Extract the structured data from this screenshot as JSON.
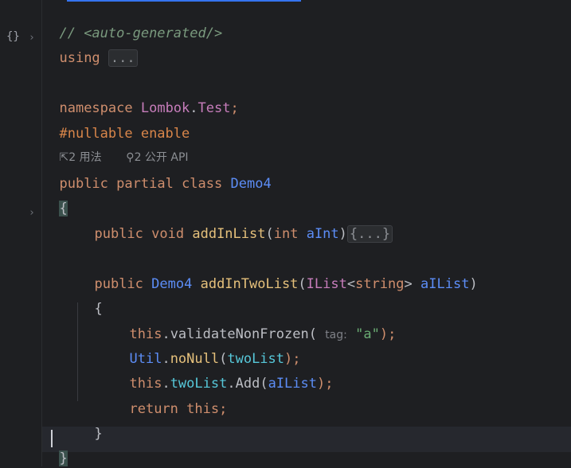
{
  "gutter": {
    "braces_icon": "{}",
    "chevron": "›"
  },
  "code": {
    "line1_comment": "// <auto-generated/>",
    "line2_kw": "using",
    "line2_fold": "...",
    "line4_kw": "namespace",
    "line4_ns1": "Lombok",
    "line4_dot": ".",
    "line4_ns2": "Test",
    "line4_semi": ";",
    "line5_pp": "#nullable enable",
    "hint_usages": "2 用法",
    "hint_api": "2 公开 API",
    "line7_kw1": "public",
    "line7_kw2": "partial",
    "line7_kw3": "class",
    "line7_type": "Demo4",
    "line8_brace": "{",
    "line9_kw1": "public",
    "line9_kw2": "void",
    "line9_fn": "addInList",
    "line9_p1": "(",
    "line9_kw3": "int",
    "line9_param": "aInt",
    "line9_p2": ")",
    "line9_fold": "{...}",
    "line11_kw": "public",
    "line11_type": "Demo4",
    "line11_fn": "addInTwoList",
    "line11_p1": "(",
    "line11_iface": "IList",
    "line11_lt": "<",
    "line11_kw2": "string",
    "line11_gt": ">",
    "line11_param": "aIList",
    "line11_p2": ")",
    "line12_brace": "{",
    "line13_this": "this",
    "line13_dot": ".",
    "line13_fn": "validateNonFrozen",
    "line13_p1": "(",
    "line13_inlay": "tag:",
    "line13_str": "\"a\"",
    "line13_end": ");",
    "line14_type": "Util",
    "line14_dot": ".",
    "line14_fn": "noNull",
    "line14_p1": "(",
    "line14_field": "twoList",
    "line14_end": ");",
    "line15_this": "this",
    "line15_dot1": ".",
    "line15_field": "twoList",
    "line15_dot2": ".",
    "line15_fn": "Add",
    "line15_p1": "(",
    "line15_param": "aIList",
    "line15_end": ");",
    "line16_kw1": "return",
    "line16_kw2": "this",
    "line16_semi": ";",
    "line17_brace": "}",
    "line18_brace": "}"
  }
}
